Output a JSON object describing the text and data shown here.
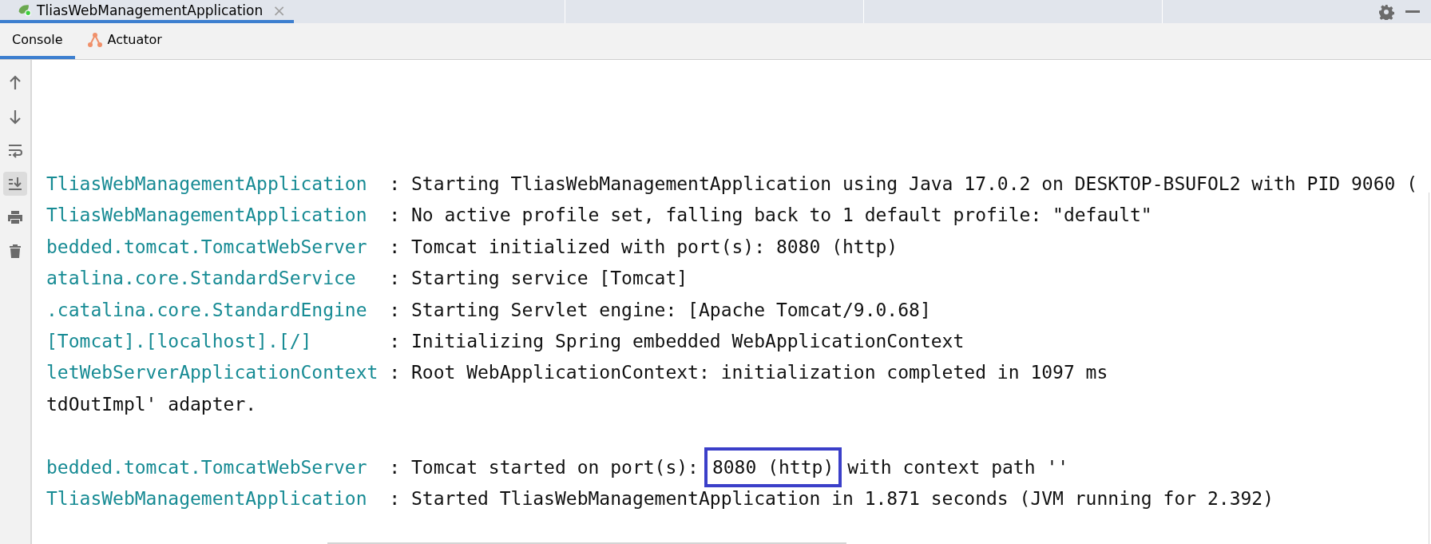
{
  "editor_tabs": [
    {
      "label": "TliasWebManagementApplication",
      "close": "×",
      "selected": true
    }
  ],
  "tool_tabs": [
    {
      "label": "Console",
      "kind": "console",
      "selected": true
    },
    {
      "label": "Actuator",
      "kind": "actuator",
      "selected": false
    }
  ],
  "toolbar": [
    {
      "kind": "up",
      "selected": false
    },
    {
      "kind": "down",
      "selected": false
    },
    {
      "kind": "wrap",
      "selected": false
    },
    {
      "kind": "scroll-end",
      "selected": true
    },
    {
      "kind": "print",
      "selected": false
    },
    {
      "kind": "trash",
      "selected": false
    }
  ],
  "log_lines": [
    {
      "kind": "log",
      "logger": "TliasWebManagementApplication",
      "parts": [
        {
          "text": ": Starting TliasWebManagementApplication using Java 17.0.2 on DESKTOP-BSUFOL2 with PID 9060 (",
          "highlighted": false
        }
      ]
    },
    {
      "kind": "log",
      "logger": "TliasWebManagementApplication",
      "parts": [
        {
          "text": ": No active profile set, falling back to 1 default profile: \"default\"",
          "highlighted": false
        }
      ]
    },
    {
      "kind": "log",
      "logger": "bedded.tomcat.TomcatWebServer",
      "parts": [
        {
          "text": ": Tomcat initialized with port(s): 8080 (http)",
          "highlighted": false
        }
      ]
    },
    {
      "kind": "log",
      "logger": "atalina.core.StandardService",
      "parts": [
        {
          "text": ": Starting service [Tomcat]",
          "highlighted": false
        }
      ]
    },
    {
      "kind": "log",
      "logger": ".catalina.core.StandardEngine",
      "parts": [
        {
          "text": ": Starting Servlet engine: [Apache Tomcat/9.0.68]",
          "highlighted": false
        }
      ]
    },
    {
      "kind": "log",
      "logger": "[Tomcat].[localhost].[/]",
      "parts": [
        {
          "text": ": Initializing Spring embedded WebApplicationContext",
          "highlighted": false
        }
      ]
    },
    {
      "kind": "log",
      "logger": "letWebServerApplicationContext",
      "parts": [
        {
          "text": ": Root WebApplicationContext: initialization completed in 1097 ms",
          "highlighted": false
        }
      ]
    },
    {
      "kind": "log",
      "parts": [
        {
          "text": "tdOutImpl' adapter.",
          "highlighted": false
        }
      ]
    },
    {
      "kind": "blank"
    },
    {
      "kind": "log",
      "logger": "bedded.tomcat.TomcatWebServer",
      "parts": [
        {
          "text": ": Tomcat started on port(s):",
          "highlighted": false
        },
        {
          "text": "8080 (http)",
          "highlighted": true
        },
        {
          "text": "with context path ''",
          "highlighted": false
        }
      ]
    },
    {
      "kind": "log",
      "logger": "TliasWebManagementApplication",
      "parts": [
        {
          "text": ": Started TliasWebManagementApplication in 1.871 seconds (JVM running for 2.392)",
          "highlighted": false
        }
      ]
    }
  ]
}
